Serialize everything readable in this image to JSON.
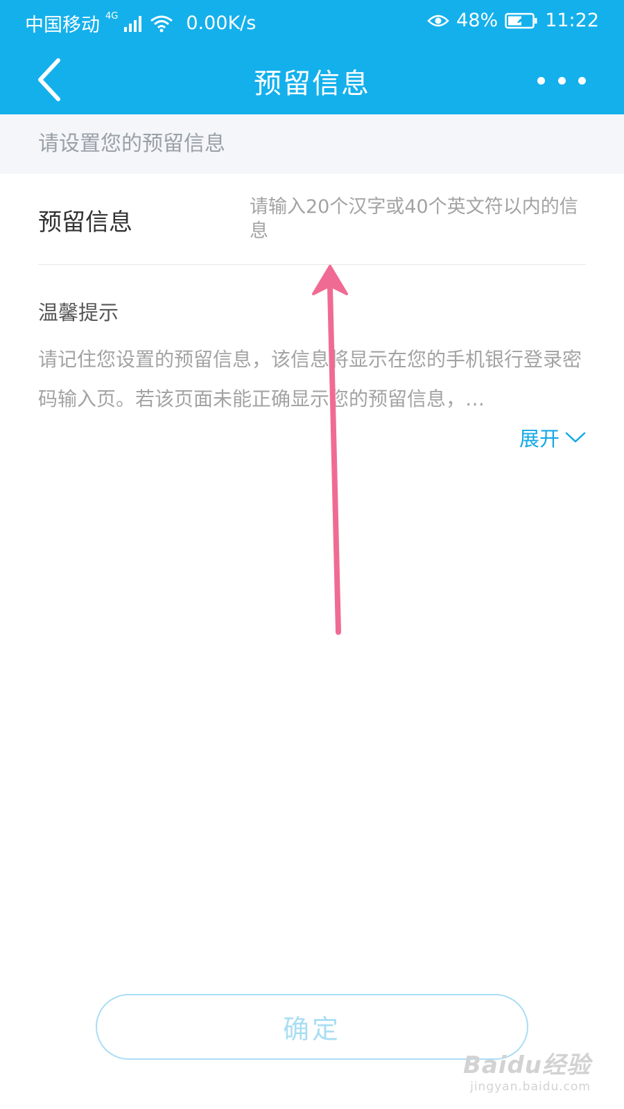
{
  "status_bar": {
    "carrier": "中国移动",
    "network": "4G",
    "speed": "0.00K/s",
    "battery": "48%",
    "time": "11:22"
  },
  "header": {
    "title": "预留信息",
    "back_icon": "chevron-left-icon",
    "more_icon": "more-dots-icon"
  },
  "section": {
    "hint": "请设置您的预留信息"
  },
  "form": {
    "label": "预留信息",
    "value": "",
    "placeholder": "请输入20个汉字或40个英文符以内的信息"
  },
  "tips": {
    "title": "温馨提示",
    "body": "请记住您设置的预留信息，该信息将显示在您的手机银行登录密码输入页。若该页面未能正确显示您的预留信息，…",
    "expand_label": "展开"
  },
  "actions": {
    "confirm_label": "确定"
  },
  "watermark": {
    "logo": "Baidu经验",
    "url": "jingyan.baidu.com"
  },
  "colors": {
    "accent": "#14b0ec",
    "link": "#14a8e6",
    "annotation": "#f06b93"
  }
}
